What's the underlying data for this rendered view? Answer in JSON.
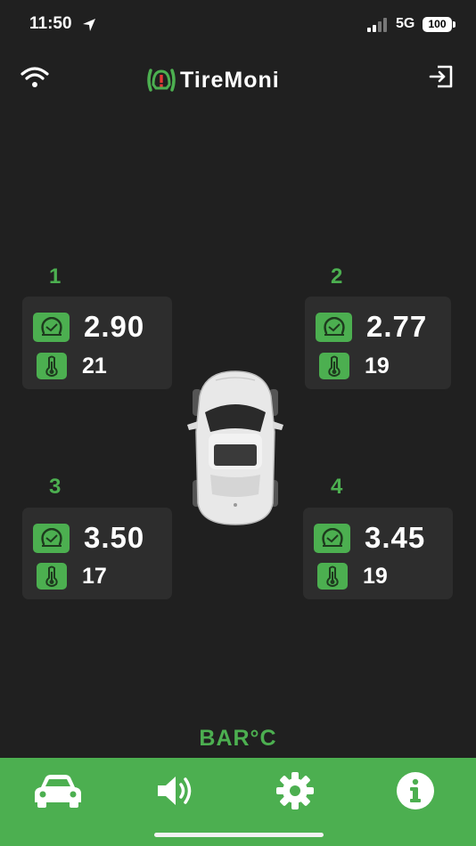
{
  "status_bar": {
    "time": "11:50",
    "network": "5G",
    "battery": "100",
    "icons": [
      "location-arrow-icon",
      "signal-bars-icon"
    ]
  },
  "header": {
    "app_name": "TireMoni",
    "icons": [
      "wifi-icon",
      "tiremoni-logo-icon",
      "logout-icon"
    ]
  },
  "tires": [
    {
      "number": "1",
      "pressure": "2.90",
      "temperature": "21"
    },
    {
      "number": "2",
      "pressure": "2.77",
      "temperature": "19"
    },
    {
      "number": "3",
      "pressure": "3.50",
      "temperature": "17"
    },
    {
      "number": "4",
      "pressure": "3.45",
      "temperature": "19"
    }
  ],
  "unit_label": "BAR°C",
  "bottom_nav": {
    "items": [
      {
        "icon": "car-icon",
        "active": true
      },
      {
        "icon": "speaker-icon",
        "active": false
      },
      {
        "icon": "gear-icon",
        "active": false
      },
      {
        "icon": "info-icon",
        "active": false
      }
    ]
  },
  "colors": {
    "background": "#202020",
    "panel": "#2d2d2d",
    "accent": "#4caf50",
    "text": "#ffffff",
    "logo_red": "#e53935"
  }
}
